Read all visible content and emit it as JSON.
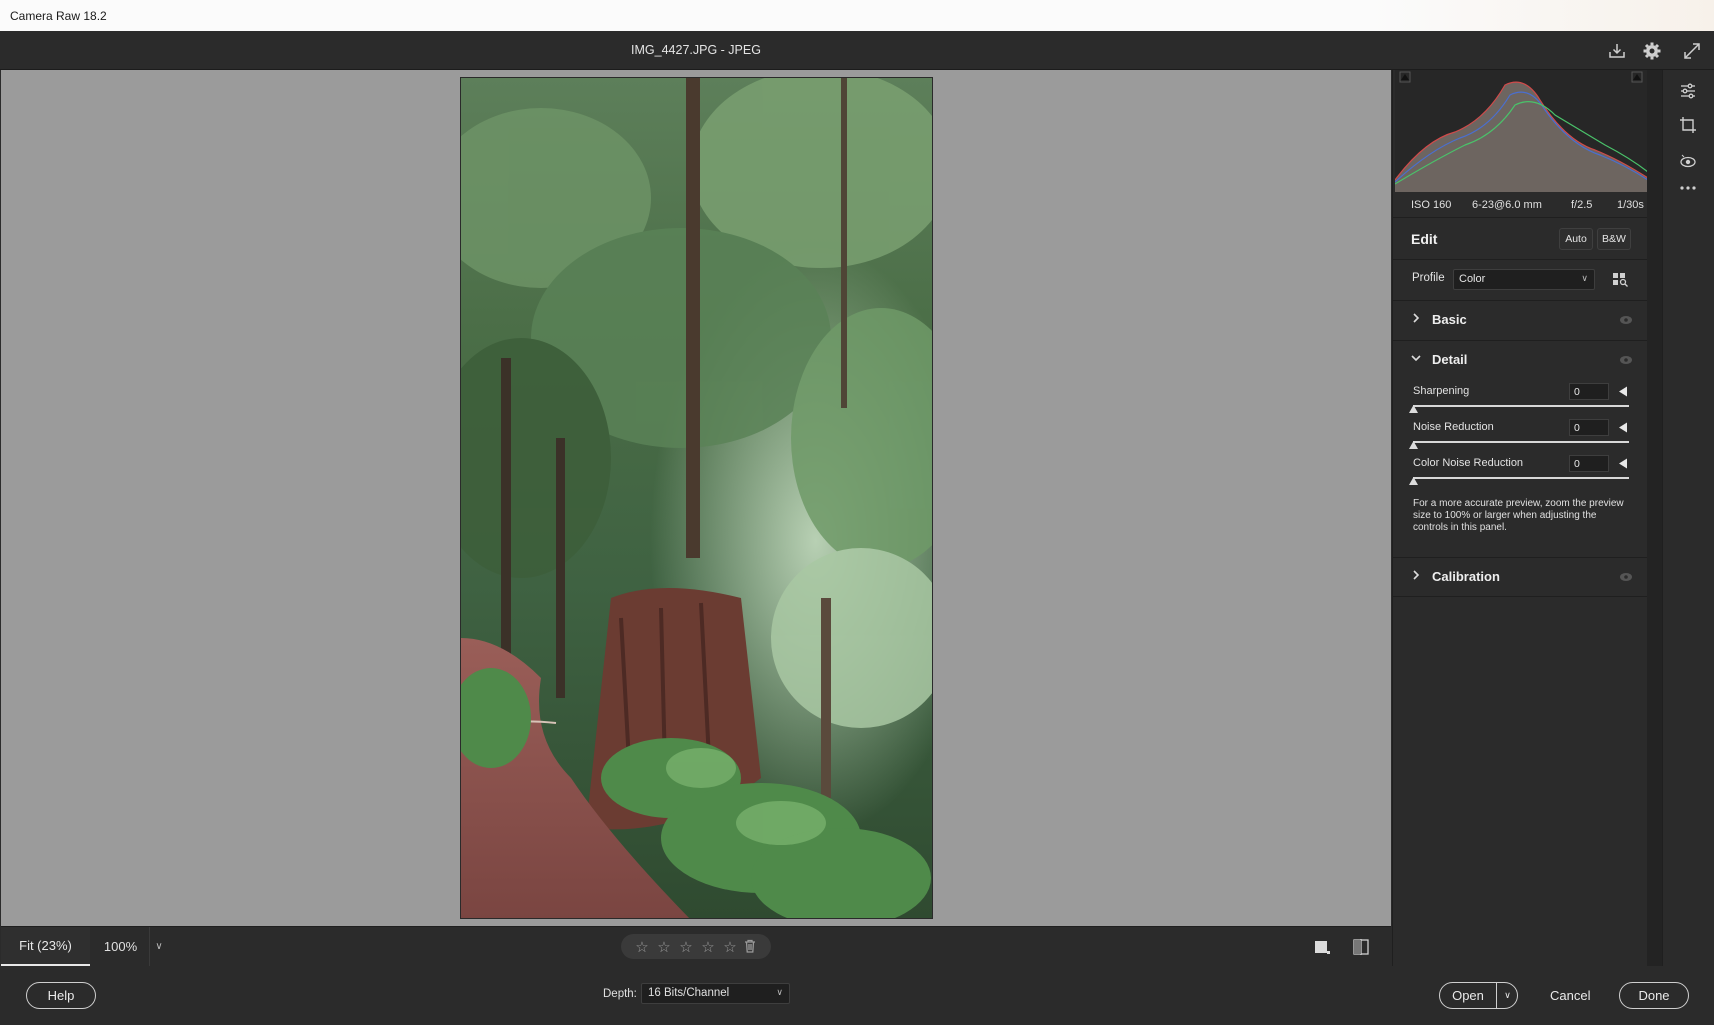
{
  "window": {
    "title": "Camera Raw 18.2"
  },
  "header": {
    "file_title": "IMG_4427.JPG  -  JPEG",
    "icons": [
      "save-icon",
      "gear-icon",
      "fullscreen-icon"
    ]
  },
  "preview": {
    "image_subject": "forest trail with redwood stump and ferns"
  },
  "zoom": {
    "fit_label": "Fit (23%)",
    "zoom_100_label": "100%"
  },
  "rating": {
    "stars": 5,
    "value": 0
  },
  "histogram": {
    "exif": {
      "iso": "ISO 160",
      "lens": "6-23@6.0 mm",
      "aperture": "f/2.5",
      "shutter": "1/30s"
    }
  },
  "edit": {
    "title": "Edit",
    "auto_label": "Auto",
    "bw_label": "B&W",
    "profile_label": "Profile",
    "profile_value": "Color"
  },
  "sections": {
    "basic": {
      "title": "Basic",
      "expanded": false
    },
    "detail": {
      "title": "Detail",
      "expanded": true,
      "sliders": [
        {
          "label": "Sharpening",
          "value": "0"
        },
        {
          "label": "Noise Reduction",
          "value": "0"
        },
        {
          "label": "Color Noise Reduction",
          "value": "0"
        }
      ],
      "note": "For a more accurate preview, zoom the preview size to 100% or larger when adjusting the controls in this panel."
    },
    "calibration": {
      "title": "Calibration",
      "expanded": false
    }
  },
  "footer": {
    "help_label": "Help",
    "depth_label": "Depth:",
    "depth_value": "16 Bits/Channel",
    "open_label": "Open",
    "cancel_label": "Cancel",
    "done_label": "Done"
  },
  "colors": {
    "panel_bg": "#2b2b2b",
    "preview_bg": "#9b9b9b",
    "accent_text": "#eaeaea"
  }
}
